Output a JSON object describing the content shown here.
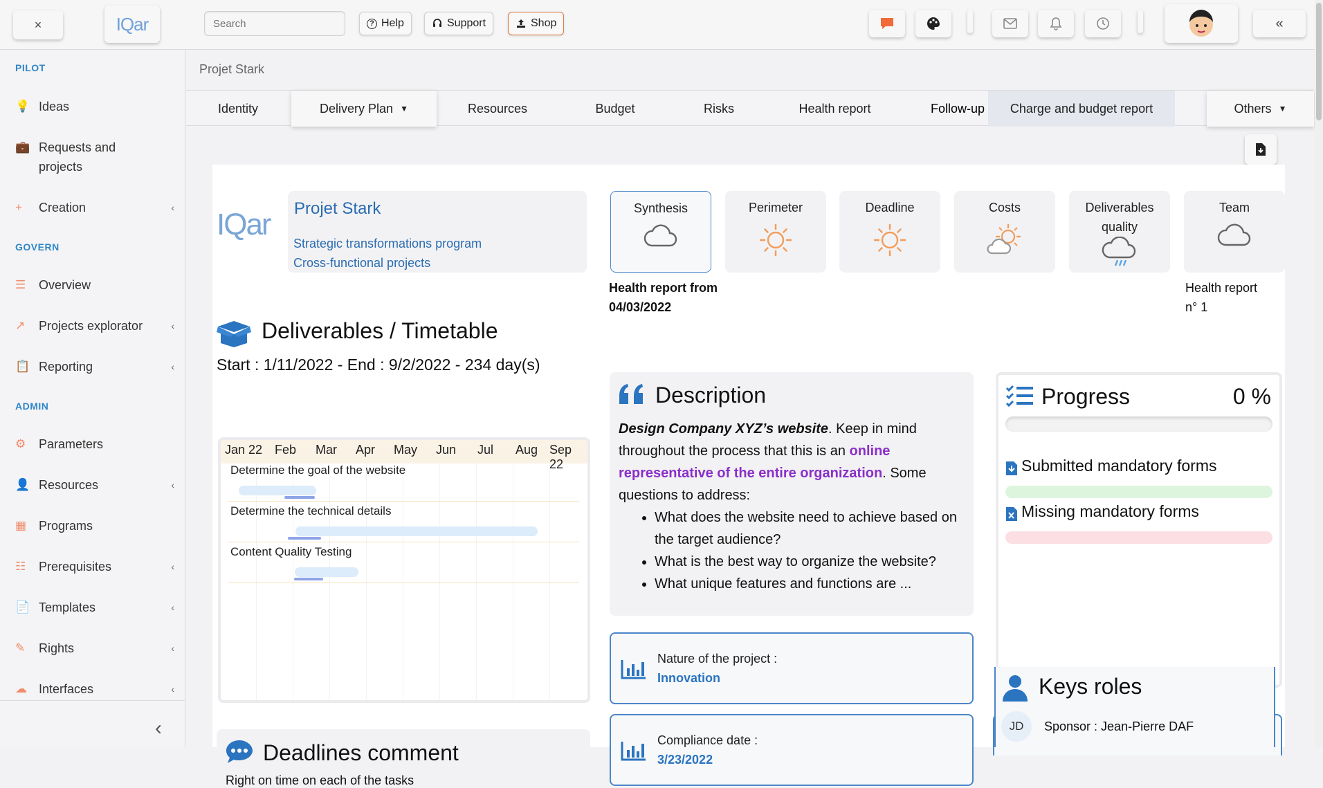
{
  "topbar": {
    "close_label": "×",
    "logo_text": "IQar",
    "search_placeholder": "Search",
    "help_label": "Help",
    "support_label": "Support",
    "shop_label": "Shop",
    "collapse_label": "«"
  },
  "sidebar": {
    "sections": {
      "pilot": "PILOT",
      "govern": "GOVERN",
      "admin": "ADMIN"
    },
    "items": [
      {
        "label": "Ideas",
        "chevron": ""
      },
      {
        "label": "Requests and projects",
        "chevron": ""
      },
      {
        "label": "Creation",
        "chevron": "‹"
      },
      {
        "label": "Overview",
        "chevron": ""
      },
      {
        "label": "Projects explorator",
        "chevron": "‹"
      },
      {
        "label": "Reporting",
        "chevron": "‹"
      },
      {
        "label": "Parameters",
        "chevron": ""
      },
      {
        "label": "Resources",
        "chevron": "‹"
      },
      {
        "label": "Programs",
        "chevron": ""
      },
      {
        "label": "Prerequisites",
        "chevron": "‹"
      },
      {
        "label": "Templates",
        "chevron": "‹"
      },
      {
        "label": "Rights",
        "chevron": "‹"
      },
      {
        "label": "Interfaces",
        "chevron": "‹"
      }
    ],
    "collapse": "‹"
  },
  "breadcrumb": "Projet Stark",
  "tabs": [
    {
      "label": "Identity"
    },
    {
      "label": "Delivery Plan"
    },
    {
      "label": "Resources"
    },
    {
      "label": "Budget"
    },
    {
      "label": "Risks"
    },
    {
      "label": "Health report"
    },
    {
      "label": "Follow-up"
    },
    {
      "label": "Charge and budget report"
    },
    {
      "label": "Others"
    }
  ],
  "project": {
    "logo_text": "IQar",
    "name": "Projet Stark",
    "program": "Strategic transformations program",
    "portfolio": "Cross-functional projects"
  },
  "weather": [
    {
      "label": "Synthesis",
      "icon": "cloud-icon"
    },
    {
      "label": "Perimeter",
      "icon": "sun-icon"
    },
    {
      "label": "Deadline",
      "icon": "sun-icon"
    },
    {
      "label": "Costs",
      "icon": "sun-cloud-icon"
    },
    {
      "label": "Deliverables quality",
      "icon": "rain-icon"
    },
    {
      "label": "Team",
      "icon": "cloud-icon"
    }
  ],
  "health": {
    "from_line1": "Health report from",
    "from_line2": "04/03/2022",
    "num_line1": "Health report",
    "num_line2": "n° 1"
  },
  "deliverables": {
    "title": "Deliverables / Timetable",
    "period": "Start : 1/11/2022 - End : 9/2/2022 - 234 day(s)",
    "months": [
      "Jan 22",
      "Feb",
      "Mar",
      "Apr",
      "May",
      "Jun",
      "Jul",
      "Aug",
      "Sep 22"
    ],
    "tasks": [
      {
        "label": "Determine the goal of the website"
      },
      {
        "label": "Determine the technical details"
      },
      {
        "label": "Content Quality Testing"
      }
    ]
  },
  "description": {
    "title": "Description",
    "lead_bold": "Design Company XYZ’s website",
    "lead_rest": ".  Keep in mind throughout the process that this is an ",
    "highlight": "online representative of the entire organization",
    "after": ". Some questions to address:",
    "bullets": [
      "What does the website need to achieve based on the target audience?",
      "What is the best way to organize the website?",
      "What unique features and functions are ..."
    ]
  },
  "progress": {
    "title": "Progress",
    "value": "0 %",
    "submitted_label": "Submitted mandatory forms",
    "missing_label": "Missing mandatory forms"
  },
  "nature": {
    "label": "Nature of the project :",
    "value": "Innovation"
  },
  "compliance": {
    "label": "Compliance date :",
    "value": "3/23/2022"
  },
  "deadlines": {
    "title": "Deadlines comment",
    "text": "Right on time on each of the tasks"
  },
  "keyroles": {
    "title": "Keys roles",
    "initials": "JD",
    "sponsor": "Sponsor : Jean-Pierre DAF"
  },
  "colors": {
    "accent": "#2f86c8",
    "highlight": "#8a2fc9",
    "link": "#2a6cb0",
    "orange": "#f39c5a"
  }
}
